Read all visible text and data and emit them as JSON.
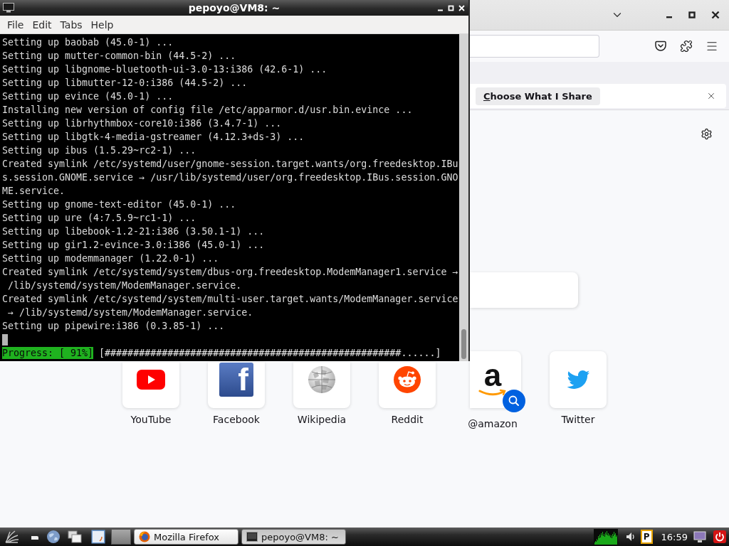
{
  "firefox_window": {
    "notification": {
      "button": "Choose What I Share"
    },
    "shortcuts": [
      {
        "label": "YouTube",
        "kind": "youtube",
        "search_badge": false
      },
      {
        "label": "Facebook",
        "kind": "facebook",
        "logo_text": "f",
        "search_badge": false
      },
      {
        "label": "Wikipedia",
        "kind": "wikipedia",
        "search_badge": false
      },
      {
        "label": "Reddit",
        "kind": "reddit",
        "search_badge": false
      },
      {
        "label": "@amazon",
        "kind": "amazon",
        "logo_text": "a",
        "search_badge": true
      },
      {
        "label": "Twitter",
        "kind": "twitter",
        "search_badge": false
      }
    ]
  },
  "terminal_window": {
    "title": "pepoyo@VM8: ~",
    "menu": [
      "File",
      "Edit",
      "Tabs",
      "Help"
    ],
    "lines": [
      "Setting up baobab (45.0-1) ...",
      "Setting up mutter-common-bin (44.5-2) ...",
      "Setting up libgnome-bluetooth-ui-3.0-13:i386 (42.6-1) ...",
      "Setting up libmutter-12-0:i386 (44.5-2) ...",
      "Setting up evince (45.0-1) ...",
      "Installing new version of config file /etc/apparmor.d/usr.bin.evince ...",
      "Setting up librhythmbox-core10:i386 (3.4.7-1) ...",
      "Setting up libgtk-4-media-gstreamer (4.12.3+ds-3) ...",
      "Setting up ibus (1.5.29~rc2-1) ...",
      "Created symlink /etc/systemd/user/gnome-session.target.wants/org.freedesktop.IBu",
      "s.session.GNOME.service → /usr/lib/systemd/user/org.freedesktop.IBus.session.GNO",
      "ME.service.",
      "Setting up gnome-text-editor (45.0-1) ...",
      "Setting up ure (4:7.5.9~rc1-1) ...",
      "Setting up libebook-1.2-21:i386 (3.50.1-1) ...",
      "Setting up gir1.2-evince-3.0:i386 (45.0-1) ...",
      "Setting up modemmanager (1.22.0-1) ...",
      "Created symlink /etc/systemd/system/dbus-org.freedesktop.ModemManager1.service →",
      " /lib/systemd/system/ModemManager.service.",
      "Created symlink /etc/systemd/system/multi-user.target.wants/ModemManager.service",
      " → /lib/systemd/system/ModemManager.service.",
      "Setting up pipewire:i386 (0.3.85-1) ..."
    ],
    "progress": {
      "label": "Progress: [ 91%]",
      "bar": "[####################################################......]"
    }
  },
  "taskbar": {
    "tasks": [
      {
        "label": "Mozilla Firefox",
        "kind": "browser",
        "selected": false
      },
      {
        "label": "pepoyo@VM8: ~",
        "kind": "terminal",
        "selected": true
      }
    ],
    "applet_letter": "P",
    "clock": "16:59"
  }
}
